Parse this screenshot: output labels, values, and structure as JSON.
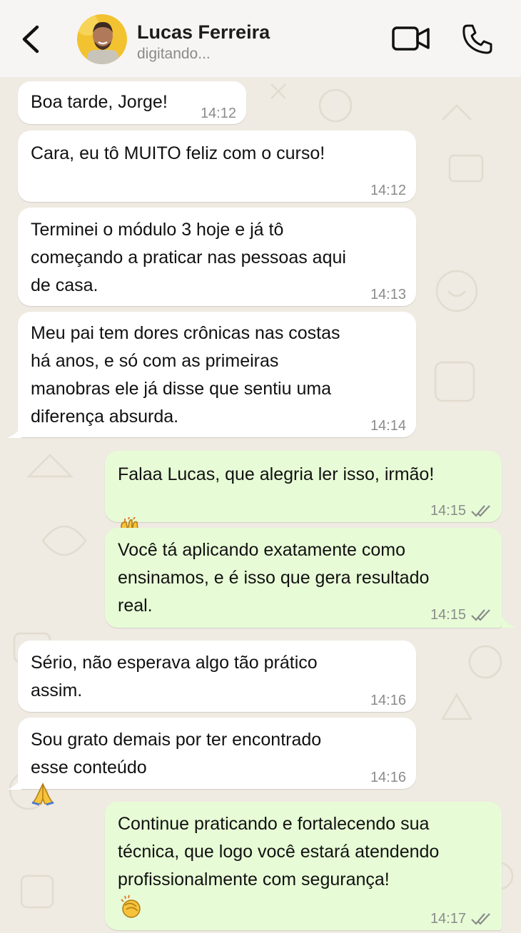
{
  "header": {
    "contact_name": "Lucas Ferreira",
    "status": "digitando...",
    "icons": [
      "back-arrow-icon",
      "video-call-icon",
      "phone-call-icon"
    ]
  },
  "messages": [
    {
      "direction": "in",
      "text": "Boa tarde, Jorge!",
      "time": "14:12"
    },
    {
      "direction": "in",
      "text": "Cara, eu tô MUITO feliz com o curso!",
      "time": "14:12"
    },
    {
      "direction": "in",
      "text": "Terminei o módulo 3 hoje e já tô\ncomeçando a praticar nas pessoas aqui\nde casa.",
      "time": "14:13"
    },
    {
      "direction": "in",
      "text": "Meu pai tem dores crônicas nas costas\nhá anos, e só com as primeiras\nmanobras ele já disse que sentiu uma\ndiferença absurda.",
      "time": "14:14"
    },
    {
      "direction": "out",
      "text": "Falaa Lucas, que alegria ler isso, irmão!",
      "emoji": "raising-hands",
      "time": "14:15",
      "read": true
    },
    {
      "direction": "out",
      "text": "Você tá aplicando exatamente como\nensinamos, e é isso que gera resultado\nreal.",
      "time": "14:15",
      "read": true
    },
    {
      "direction": "in",
      "text": "Sério, não esperava algo tão prático\nassim.",
      "time": "14:16"
    },
    {
      "direction": "in",
      "text": "Sou grato demais por ter encontrado\nesse conteúdo",
      "emoji": "folded-hands",
      "time": "14:16"
    },
    {
      "direction": "out",
      "text": "Continue praticando e fortalecendo sua\ntécnica, que logo você estará atendendo\nprofissionalmente com segurança!",
      "emoji": "clapping-hands",
      "time": "14:17",
      "read": true
    }
  ],
  "colors": {
    "header_bg": "#f6f5f3",
    "chat_bg": "#efeae2",
    "incoming_bubble": "#ffffff",
    "outgoing_bubble": "#e7fcd6",
    "timestamp": "#8b8b8b"
  }
}
